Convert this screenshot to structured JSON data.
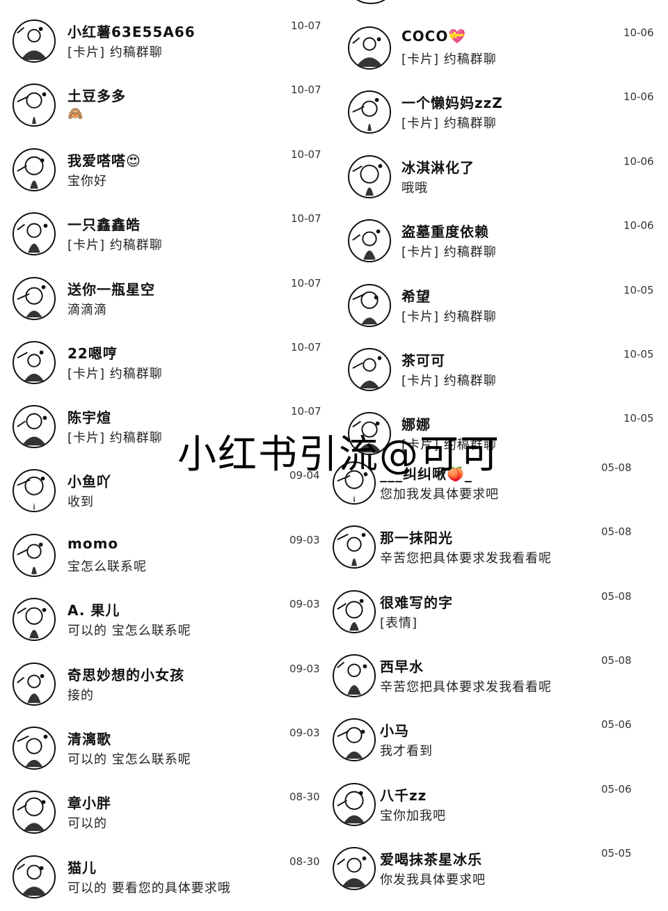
{
  "watermark": "小红书引流@可可",
  "left_chats": [
    {
      "name": "小红薯63E55A66",
      "message": "[卡片] 约稿群聊",
      "date": "10-07",
      "avatar_icon": "mountain-landscape-avatar"
    },
    {
      "name": "土豆多多",
      "message": "🙈",
      "date": "10-07",
      "avatar_icon": "couple-avatar"
    },
    {
      "name": "我爱嗒嗒😍",
      "message": "宝你好",
      "date": "10-07",
      "avatar_icon": "cartoon-face-avatar"
    },
    {
      "name": "一只鑫鑫皓",
      "message": "[卡片] 约稿群聊",
      "date": "10-07",
      "avatar_icon": "person-portrait-avatar"
    },
    {
      "name": "送你一瓶星空",
      "message": "滴滴滴",
      "date": "10-07",
      "avatar_icon": "cartoon-scene-avatar"
    },
    {
      "name": "22嗯哼",
      "message": "[卡片] 约稿群聊",
      "date": "10-07",
      "avatar_icon": "abstract-avatar"
    },
    {
      "name": "陈宇煊",
      "message": "[卡片] 约稿群聊",
      "date": "10-07",
      "avatar_icon": "pattern-avatar"
    },
    {
      "name": "小鱼吖",
      "message": "收到",
      "date": "09-04",
      "avatar_icon": "anime-girl-avatar"
    },
    {
      "name": "momo",
      "message": "宝怎么联系呢",
      "date": "09-03",
      "avatar_icon": "cute-creature-avatar"
    },
    {
      "name": "A. 果儿",
      "message": "可以的 宝怎么联系呢",
      "date": "09-03",
      "avatar_icon": "woman-portrait-avatar"
    },
    {
      "name": "奇思妙想的小女孩",
      "message": "接的",
      "date": "09-03",
      "avatar_icon": "ring-avatar"
    },
    {
      "name": "清漓歌",
      "message": "可以的 宝怎么联系呢",
      "date": "09-03",
      "avatar_icon": "illustration-girl-avatar"
    },
    {
      "name": "章小胖",
      "message": "可以的",
      "date": "08-30",
      "avatar_icon": "sketch-avatar"
    },
    {
      "name": "猫儿",
      "message": "可以的 要看您的具体要求哦",
      "date": "08-30",
      "avatar_icon": "cat-avatar"
    }
  ],
  "right_chats": [
    {
      "name": "COCO💝",
      "message": "[卡片] 约稿群聊",
      "date": "10-06",
      "avatar_icon": "donut-avatar"
    },
    {
      "name": "一个懒妈妈zzZ",
      "message": "[卡片] 约稿群聊",
      "date": "10-06",
      "avatar_icon": "shop-avatar"
    },
    {
      "name": "冰淇淋化了",
      "message": "哦哦",
      "date": "10-06",
      "avatar_icon": "flowers-avatar"
    },
    {
      "name": "盗墓重度依赖",
      "message": "[卡片] 约稿群聊",
      "date": "10-06",
      "avatar_icon": "door-avatar"
    },
    {
      "name": "希望",
      "message": "[卡片] 约稿群聊",
      "date": "10-05",
      "avatar_icon": "moon-avatar"
    },
    {
      "name": "茶可可",
      "message": "[卡片] 约稿群聊",
      "date": "10-05",
      "avatar_icon": "girl-sketch-avatar"
    },
    {
      "name": "娜娜",
      "message": "[卡片] 约稿群聊",
      "date": "10-05",
      "avatar_icon": "hat-avatar"
    },
    {
      "name": "___纠纠啾🍑_",
      "message": "您加我发具体要求吧",
      "date": "05-08",
      "avatar_icon": "comic-avatar"
    },
    {
      "name": "那一抹阳光",
      "message": "辛苦您把具体要求发我看看呢",
      "date": "05-08",
      "avatar_icon": "pizza-avatar"
    },
    {
      "name": "很难写的字",
      "message": "[表情]",
      "date": "05-08",
      "avatar_icon": "lady-avatar"
    },
    {
      "name": "西早水",
      "message": "辛苦您把具体要求发我看看呢",
      "date": "05-08",
      "avatar_icon": "cheese-avatar"
    },
    {
      "name": "小马",
      "message": "我才看到",
      "date": "05-06",
      "avatar_icon": "smiley-avatar"
    },
    {
      "name": "八千zz",
      "message": "宝你加我吧",
      "date": "05-06",
      "avatar_icon": "animal-avatar"
    },
    {
      "name": "爱喝抹茶星冰乐",
      "message": "你发我具体要求吧",
      "date": "05-05",
      "avatar_icon": "floral-avatar"
    }
  ]
}
